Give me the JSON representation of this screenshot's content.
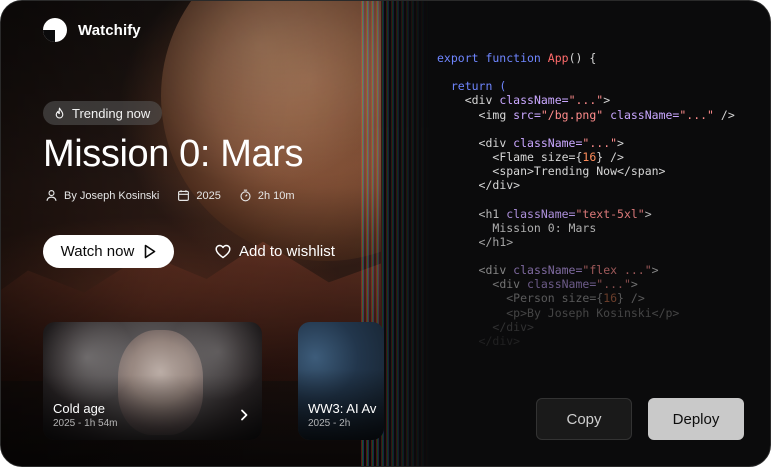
{
  "app": {
    "name": "Watchify"
  },
  "hero": {
    "badge": "Trending now",
    "title": "Mission 0: Mars",
    "meta": {
      "director": "By Joseph Kosinski",
      "year": "2025",
      "duration": "2h 10m"
    },
    "watch_label": "Watch now",
    "wishlist_label": "Add to wishlist"
  },
  "cards": [
    {
      "title": "Cold age",
      "sub": "2025 - 1h 54m"
    },
    {
      "title": "WW3: AI Av",
      "sub": "2025 - 2h"
    }
  ],
  "code": {
    "l1_kw": "export function",
    "l1_fn": "App",
    "l1_rest": "() {",
    "l2": "return (",
    "l3_tag": "<div ",
    "l3_attr": "className=",
    "l3_str": "\"...\"",
    "l3_end": ">",
    "l4_tag": "<img ",
    "l4_attr": "src=",
    "l4_str": "\"/bg.png\"",
    "l4_attr2": " className=",
    "l4_str2": "\"...\"",
    "l4_end": " />",
    "l5_tag": "<div ",
    "l5_attr": "className=",
    "l5_str": "\"...\"",
    "l5_end": ">",
    "l6_a": "<Flame size={",
    "l6_num": "16",
    "l6_b": "} />",
    "l7": "<span>Trending Now</span>",
    "l8": "</div>",
    "l9_tag": "<h1 ",
    "l9_attr": "className=",
    "l9_str": "\"text-5xl\"",
    "l9_end": ">",
    "l10": "Mission 0: Mars",
    "l11": "</h1>",
    "l12_tag": "<div ",
    "l12_attr": "className=",
    "l12_str": "\"flex ...\"",
    "l12_end": ">",
    "l13_tag": "<div ",
    "l13_attr": "className=",
    "l13_str": "\"...\"",
    "l13_end": ">",
    "l14_a": "<Person size={",
    "l14_num": "16",
    "l14_b": "} />",
    "l15": "<p>By Joseph Kosinski</p>",
    "l16": "</div>",
    "l17": "</div>"
  },
  "actions": {
    "copy": "Copy",
    "deploy": "Deploy"
  }
}
